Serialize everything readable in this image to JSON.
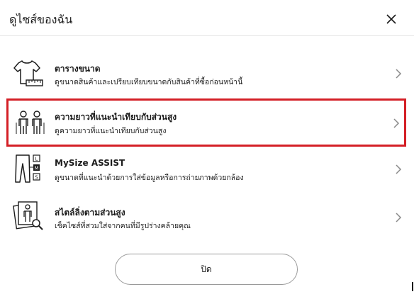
{
  "dialog": {
    "title": "ดูไซส์ของฉัน"
  },
  "options": [
    {
      "title": "ตารางขนาด",
      "subtitle": "ดูขนาดสินค้าและเปรียบเทียบขนาดกับสินค้าที่ซื้อก่อนหน้านี้",
      "icon": "tshirt-ruler-icon"
    },
    {
      "title": "ความยาวที่แนะนำเทียบกับส่วนสูง",
      "subtitle": "ดูความยาวที่แนะนำเทียบกับส่วนสูง",
      "icon": "people-height-icon",
      "selected": true
    },
    {
      "title": "MySize ASSIST",
      "subtitle": "ดูขนาดที่แนะนำด้วยการใส่ข้อมูลหรือการถ่ายภาพด้วยกล้อง",
      "icon": "pants-size-icon"
    },
    {
      "title": "สไตล์ลิ่งตามส่วนสูง",
      "subtitle": "เช็คไซส์ที่สวมใส่จากคนที่มีรูปร่างคล้ายคุณ",
      "icon": "photo-search-icon"
    }
  ],
  "footer": {
    "close_label": "ปิด"
  },
  "colors": {
    "highlight": "#d41f26",
    "divider": "#e6e6e6",
    "text": "#1b1b1b"
  }
}
